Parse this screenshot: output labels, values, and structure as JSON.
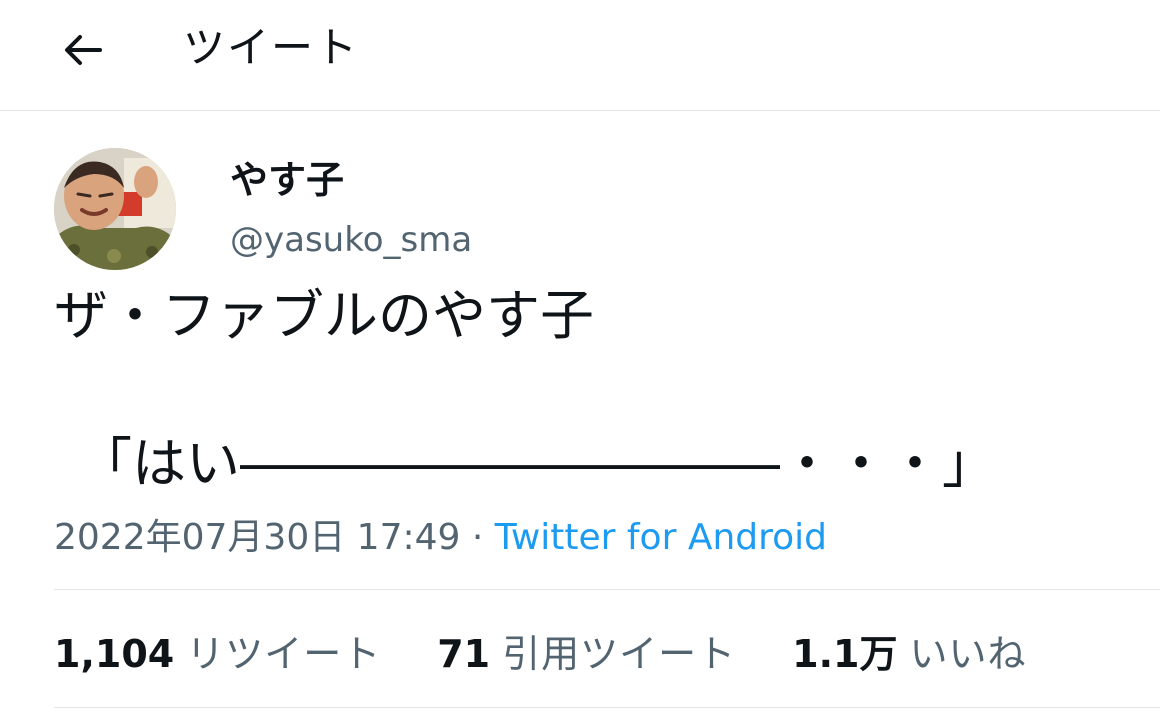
{
  "header": {
    "title": "ツイート",
    "back_icon": "arrow-left-icon"
  },
  "author": {
    "display_name": "やす子",
    "handle": "@yasuko_sma"
  },
  "tweet": {
    "line1": "ザ・ファブルのやす子",
    "line2": "「はい――――――――――・・・」"
  },
  "meta": {
    "timestamp": "2022年07月30日 17:49",
    "separator": " · ",
    "source": "Twitter for Android"
  },
  "stats": [
    {
      "count": "1,104",
      "label": "リツイート"
    },
    {
      "count": "71",
      "label": "引用ツイート"
    },
    {
      "count": "1.1万",
      "label": "いいね"
    }
  ],
  "colors": {
    "accent": "#1d9bf0",
    "secondary_text": "#536471",
    "divider": "#e3e6e8"
  }
}
